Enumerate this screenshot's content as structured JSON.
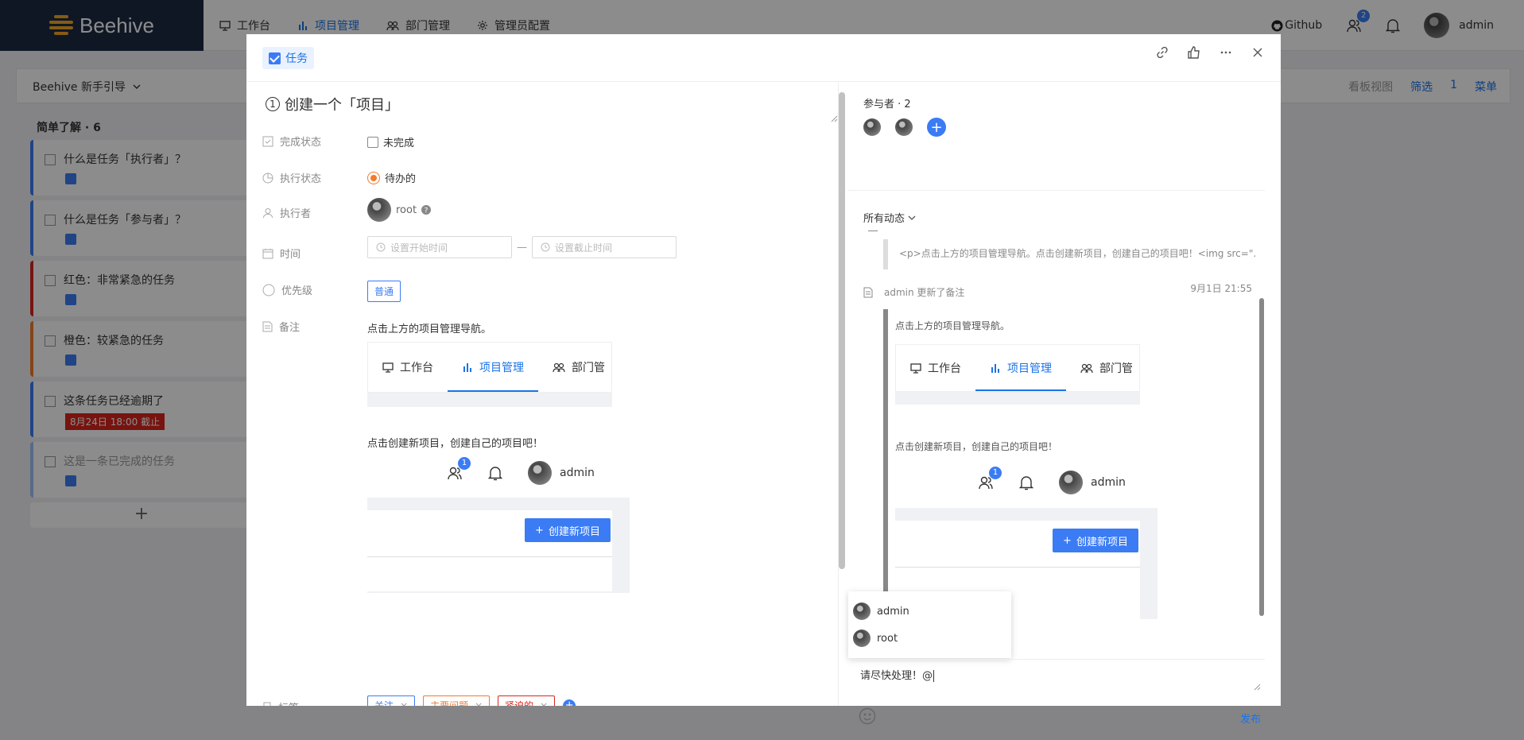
{
  "app": {
    "name": "Beehive"
  },
  "topnav": {
    "items": [
      {
        "label": "工作台",
        "icon": "desktop-icon"
      },
      {
        "label": "项目管理",
        "icon": "bar-chart-icon",
        "active": true
      },
      {
        "label": "部门管理",
        "icon": "team-icon"
      },
      {
        "label": "管理员配置",
        "icon": "gear-icon"
      }
    ],
    "github": "Github",
    "user_badge": "2",
    "username": "admin"
  },
  "board": {
    "project": "Beehive 新手引导",
    "actions": [
      "看板视图",
      "筛选",
      "1",
      "菜单"
    ],
    "column_title": "简单了解 · 6",
    "cards": [
      {
        "title": "什么是任务「执行者」？",
        "color": "#3b7cf5"
      },
      {
        "title": "什么是任务「参与者」？",
        "color": "#3b7cf5"
      },
      {
        "title": "红色：非常紧急的任务",
        "color": "#d9251c"
      },
      {
        "title": "橙色：较紧急的任务",
        "color": "#f37a2c"
      },
      {
        "title": "这条任务已经逾期了",
        "color": "#3b7cf5",
        "due": "8月24日 18:00 截止"
      },
      {
        "title": "这是一条已完成的任务",
        "color": "#3b7cf5"
      }
    ],
    "add_label": "+"
  },
  "modal": {
    "type_tag": "任务",
    "title_num": "1",
    "title": "创建一个「项目」",
    "fields": {
      "status_label": "完成状态",
      "status_value": "未完成",
      "exec_label": "执行状态",
      "exec_value": "待办的",
      "assignee_label": "执行者",
      "assignee_value": "root",
      "time_label": "时间",
      "start_placeholder": "设置开始时间",
      "end_placeholder": "设置截止时间",
      "time_sep": "—",
      "priority_label": "优先级",
      "priority_value": "普通",
      "note_label": "备注",
      "tags_label": "标签"
    },
    "note": {
      "line1": "点击上方的项目管理导航。",
      "nav_items": [
        "工作台",
        "项目管理",
        "部门管"
      ],
      "line2": "点击创建新项目，创建自己的项目吧！",
      "badge": "1",
      "user": "admin",
      "create_btn": "创建新项目"
    },
    "tags": [
      {
        "label": "关注",
        "color": "#3b7cf5"
      },
      {
        "label": "主要问题",
        "color": "#f37a2c"
      },
      {
        "label": "紧迫的",
        "color": "#d9251c"
      }
    ]
  },
  "activity": {
    "participants_label": "参与者 · 2",
    "filter": "所有动态",
    "quote": "<p>点击上方的项目管理导航。点击创建新项目，创建自己的项目吧！<img src=\"...",
    "entry_text": "admin 更新了备注",
    "entry_time": "9月1日 21:55",
    "entry_line1": "点击上方的项目管理导航。",
    "entry_nav": [
      "工作台",
      "项目管理",
      "部门管"
    ],
    "entry_line2": "点击创建新项目，创建自己的项目吧！",
    "entry_badge": "1",
    "entry_user": "admin",
    "entry_btn": "创建新项目",
    "mentions": [
      "admin",
      "root"
    ],
    "comment": "请尽快处理！@",
    "publish": "发布"
  }
}
